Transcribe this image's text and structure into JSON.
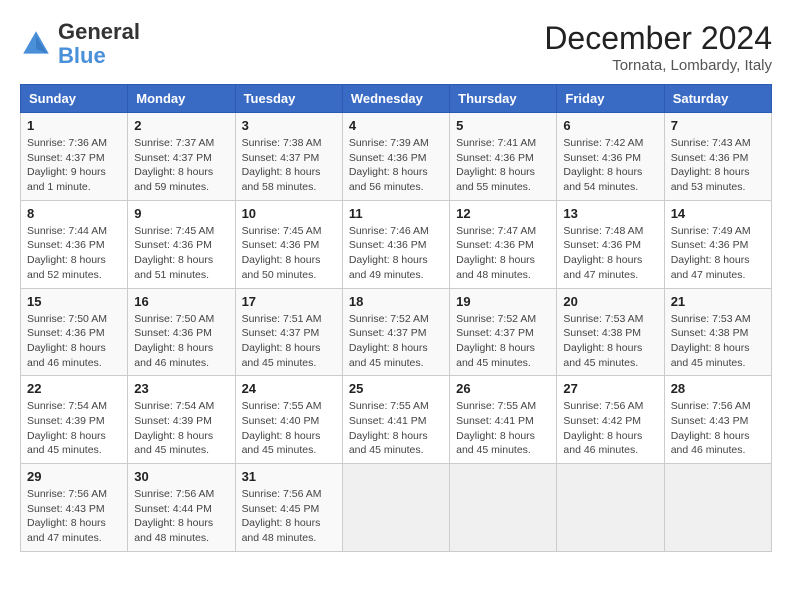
{
  "header": {
    "logo_line1": "General",
    "logo_line2": "Blue",
    "month": "December 2024",
    "location": "Tornata, Lombardy, Italy"
  },
  "weekdays": [
    "Sunday",
    "Monday",
    "Tuesday",
    "Wednesday",
    "Thursday",
    "Friday",
    "Saturday"
  ],
  "weeks": [
    [
      {
        "day": "1",
        "detail": "Sunrise: 7:36 AM\nSunset: 4:37 PM\nDaylight: 9 hours\nand 1 minute."
      },
      {
        "day": "2",
        "detail": "Sunrise: 7:37 AM\nSunset: 4:37 PM\nDaylight: 8 hours\nand 59 minutes."
      },
      {
        "day": "3",
        "detail": "Sunrise: 7:38 AM\nSunset: 4:37 PM\nDaylight: 8 hours\nand 58 minutes."
      },
      {
        "day": "4",
        "detail": "Sunrise: 7:39 AM\nSunset: 4:36 PM\nDaylight: 8 hours\nand 56 minutes."
      },
      {
        "day": "5",
        "detail": "Sunrise: 7:41 AM\nSunset: 4:36 PM\nDaylight: 8 hours\nand 55 minutes."
      },
      {
        "day": "6",
        "detail": "Sunrise: 7:42 AM\nSunset: 4:36 PM\nDaylight: 8 hours\nand 54 minutes."
      },
      {
        "day": "7",
        "detail": "Sunrise: 7:43 AM\nSunset: 4:36 PM\nDaylight: 8 hours\nand 53 minutes."
      }
    ],
    [
      {
        "day": "8",
        "detail": "Sunrise: 7:44 AM\nSunset: 4:36 PM\nDaylight: 8 hours\nand 52 minutes."
      },
      {
        "day": "9",
        "detail": "Sunrise: 7:45 AM\nSunset: 4:36 PM\nDaylight: 8 hours\nand 51 minutes."
      },
      {
        "day": "10",
        "detail": "Sunrise: 7:45 AM\nSunset: 4:36 PM\nDaylight: 8 hours\nand 50 minutes."
      },
      {
        "day": "11",
        "detail": "Sunrise: 7:46 AM\nSunset: 4:36 PM\nDaylight: 8 hours\nand 49 minutes."
      },
      {
        "day": "12",
        "detail": "Sunrise: 7:47 AM\nSunset: 4:36 PM\nDaylight: 8 hours\nand 48 minutes."
      },
      {
        "day": "13",
        "detail": "Sunrise: 7:48 AM\nSunset: 4:36 PM\nDaylight: 8 hours\nand 47 minutes."
      },
      {
        "day": "14",
        "detail": "Sunrise: 7:49 AM\nSunset: 4:36 PM\nDaylight: 8 hours\nand 47 minutes."
      }
    ],
    [
      {
        "day": "15",
        "detail": "Sunrise: 7:50 AM\nSunset: 4:36 PM\nDaylight: 8 hours\nand 46 minutes."
      },
      {
        "day": "16",
        "detail": "Sunrise: 7:50 AM\nSunset: 4:36 PM\nDaylight: 8 hours\nand 46 minutes."
      },
      {
        "day": "17",
        "detail": "Sunrise: 7:51 AM\nSunset: 4:37 PM\nDaylight: 8 hours\nand 45 minutes."
      },
      {
        "day": "18",
        "detail": "Sunrise: 7:52 AM\nSunset: 4:37 PM\nDaylight: 8 hours\nand 45 minutes."
      },
      {
        "day": "19",
        "detail": "Sunrise: 7:52 AM\nSunset: 4:37 PM\nDaylight: 8 hours\nand 45 minutes."
      },
      {
        "day": "20",
        "detail": "Sunrise: 7:53 AM\nSunset: 4:38 PM\nDaylight: 8 hours\nand 45 minutes."
      },
      {
        "day": "21",
        "detail": "Sunrise: 7:53 AM\nSunset: 4:38 PM\nDaylight: 8 hours\nand 45 minutes."
      }
    ],
    [
      {
        "day": "22",
        "detail": "Sunrise: 7:54 AM\nSunset: 4:39 PM\nDaylight: 8 hours\nand 45 minutes."
      },
      {
        "day": "23",
        "detail": "Sunrise: 7:54 AM\nSunset: 4:39 PM\nDaylight: 8 hours\nand 45 minutes."
      },
      {
        "day": "24",
        "detail": "Sunrise: 7:55 AM\nSunset: 4:40 PM\nDaylight: 8 hours\nand 45 minutes."
      },
      {
        "day": "25",
        "detail": "Sunrise: 7:55 AM\nSunset: 4:41 PM\nDaylight: 8 hours\nand 45 minutes."
      },
      {
        "day": "26",
        "detail": "Sunrise: 7:55 AM\nSunset: 4:41 PM\nDaylight: 8 hours\nand 45 minutes."
      },
      {
        "day": "27",
        "detail": "Sunrise: 7:56 AM\nSunset: 4:42 PM\nDaylight: 8 hours\nand 46 minutes."
      },
      {
        "day": "28",
        "detail": "Sunrise: 7:56 AM\nSunset: 4:43 PM\nDaylight: 8 hours\nand 46 minutes."
      }
    ],
    [
      {
        "day": "29",
        "detail": "Sunrise: 7:56 AM\nSunset: 4:43 PM\nDaylight: 8 hours\nand 47 minutes."
      },
      {
        "day": "30",
        "detail": "Sunrise: 7:56 AM\nSunset: 4:44 PM\nDaylight: 8 hours\nand 48 minutes."
      },
      {
        "day": "31",
        "detail": "Sunrise: 7:56 AM\nSunset: 4:45 PM\nDaylight: 8 hours\nand 48 minutes."
      },
      null,
      null,
      null,
      null
    ]
  ]
}
